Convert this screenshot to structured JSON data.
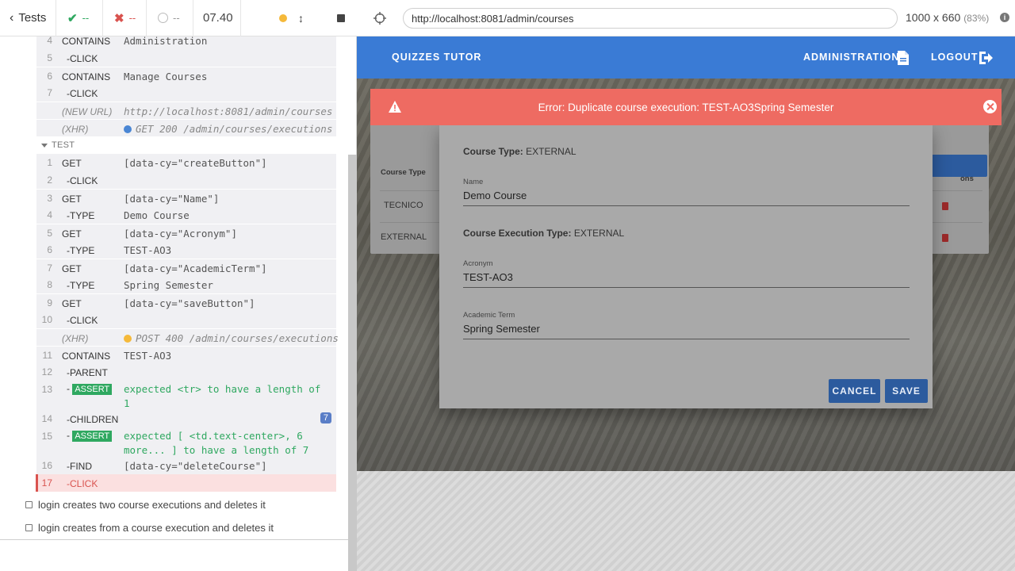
{
  "reporter": {
    "header": {
      "tests_label": "Tests",
      "passed": "--",
      "failed": "--",
      "pending": "--",
      "duration": "07.40"
    },
    "commands_top": [
      {
        "num": "4",
        "name": "CONTAINS",
        "msg": "Administration"
      },
      {
        "num": "5",
        "name": "-CLICK",
        "msg": ""
      },
      {
        "num": "6",
        "name": "CONTAINS",
        "msg": "Manage Courses"
      },
      {
        "num": "7",
        "name": "-CLICK",
        "msg": ""
      },
      {
        "num": "",
        "name": "(NEW URL)",
        "msg": "http://localhost:8081/admin/courses"
      },
      {
        "num": "",
        "name": "(XHR)",
        "msg": "GET 200 /admin/courses/executions"
      }
    ],
    "test_label": "TEST",
    "commands_test": [
      {
        "num": "1",
        "name": "GET",
        "msg": "[data-cy=\"createButton\"]"
      },
      {
        "num": "2",
        "name": "-CLICK",
        "msg": ""
      },
      {
        "num": "3",
        "name": "GET",
        "msg": "[data-cy=\"Name\"]"
      },
      {
        "num": "4",
        "name": "-TYPE",
        "msg": "Demo Course"
      },
      {
        "num": "5",
        "name": "GET",
        "msg": "[data-cy=\"Acronym\"]"
      },
      {
        "num": "6",
        "name": "-TYPE",
        "msg": "TEST-AO3"
      },
      {
        "num": "7",
        "name": "GET",
        "msg": "[data-cy=\"AcademicTerm\"]"
      },
      {
        "num": "8",
        "name": "-TYPE",
        "msg": "Spring Semester"
      },
      {
        "num": "9",
        "name": "GET",
        "msg": "[data-cy=\"saveButton\"]"
      },
      {
        "num": "10",
        "name": "-CLICK",
        "msg": ""
      },
      {
        "num": "",
        "name": "(XHR)",
        "msg": "POST 400 /admin/courses/executions"
      },
      {
        "num": "11",
        "name": "CONTAINS",
        "msg": "TEST-AO3"
      },
      {
        "num": "12",
        "name": "-PARENT",
        "msg": ""
      },
      {
        "num": "13",
        "name": "-",
        "assert": "ASSERT",
        "msg": "expected <tr> to have a length of 1"
      },
      {
        "num": "14",
        "name": "-CHILDREN",
        "msg": "",
        "badge": "7"
      },
      {
        "num": "15",
        "name": "-",
        "assert": "ASSERT",
        "msg": "expected [ <td.text-center>, 6 more... ] to have a length of 7"
      },
      {
        "num": "16",
        "name": "-FIND",
        "msg": "[data-cy=\"deleteCourse\"]"
      },
      {
        "num": "17",
        "name": "-CLICK",
        "msg": ""
      }
    ],
    "other_tests": [
      "login creates two course executions and deletes it",
      "login creates from a course execution and deletes it"
    ]
  },
  "aut": {
    "url": "http://localhost:8081/admin/courses",
    "viewport": "1000 x 660",
    "scale": "(83%)",
    "app_title": "QUIZZES TUTOR",
    "nav_admin": "ADMINISTRATION",
    "nav_logout": "LOGOUT",
    "error_message": "Error: Duplicate course execution: TEST-AO3Spring Semester",
    "background_table": {
      "header_left": "Course Type",
      "header_right": "ons",
      "rows": [
        "TECNICO",
        "EXTERNAL"
      ]
    },
    "dialog": {
      "course_type_label": "Course Type:",
      "course_type_value": "EXTERNAL",
      "name_label": "Name",
      "name_value": "Demo Course",
      "exec_type_label": "Course Execution Type:",
      "exec_type_value": "EXTERNAL",
      "acronym_label": "Acronym",
      "acronym_value": "TEST-AO3",
      "term_label": "Academic Term",
      "term_value": "Spring Semester",
      "cancel": "CANCEL",
      "save": "SAVE"
    }
  },
  "colors": {
    "app_bar": "#3a7bd5",
    "error": "#ee6b62",
    "pass": "#2fa860",
    "fail": "#d9534f",
    "pending_dot": "#f5b93a"
  }
}
